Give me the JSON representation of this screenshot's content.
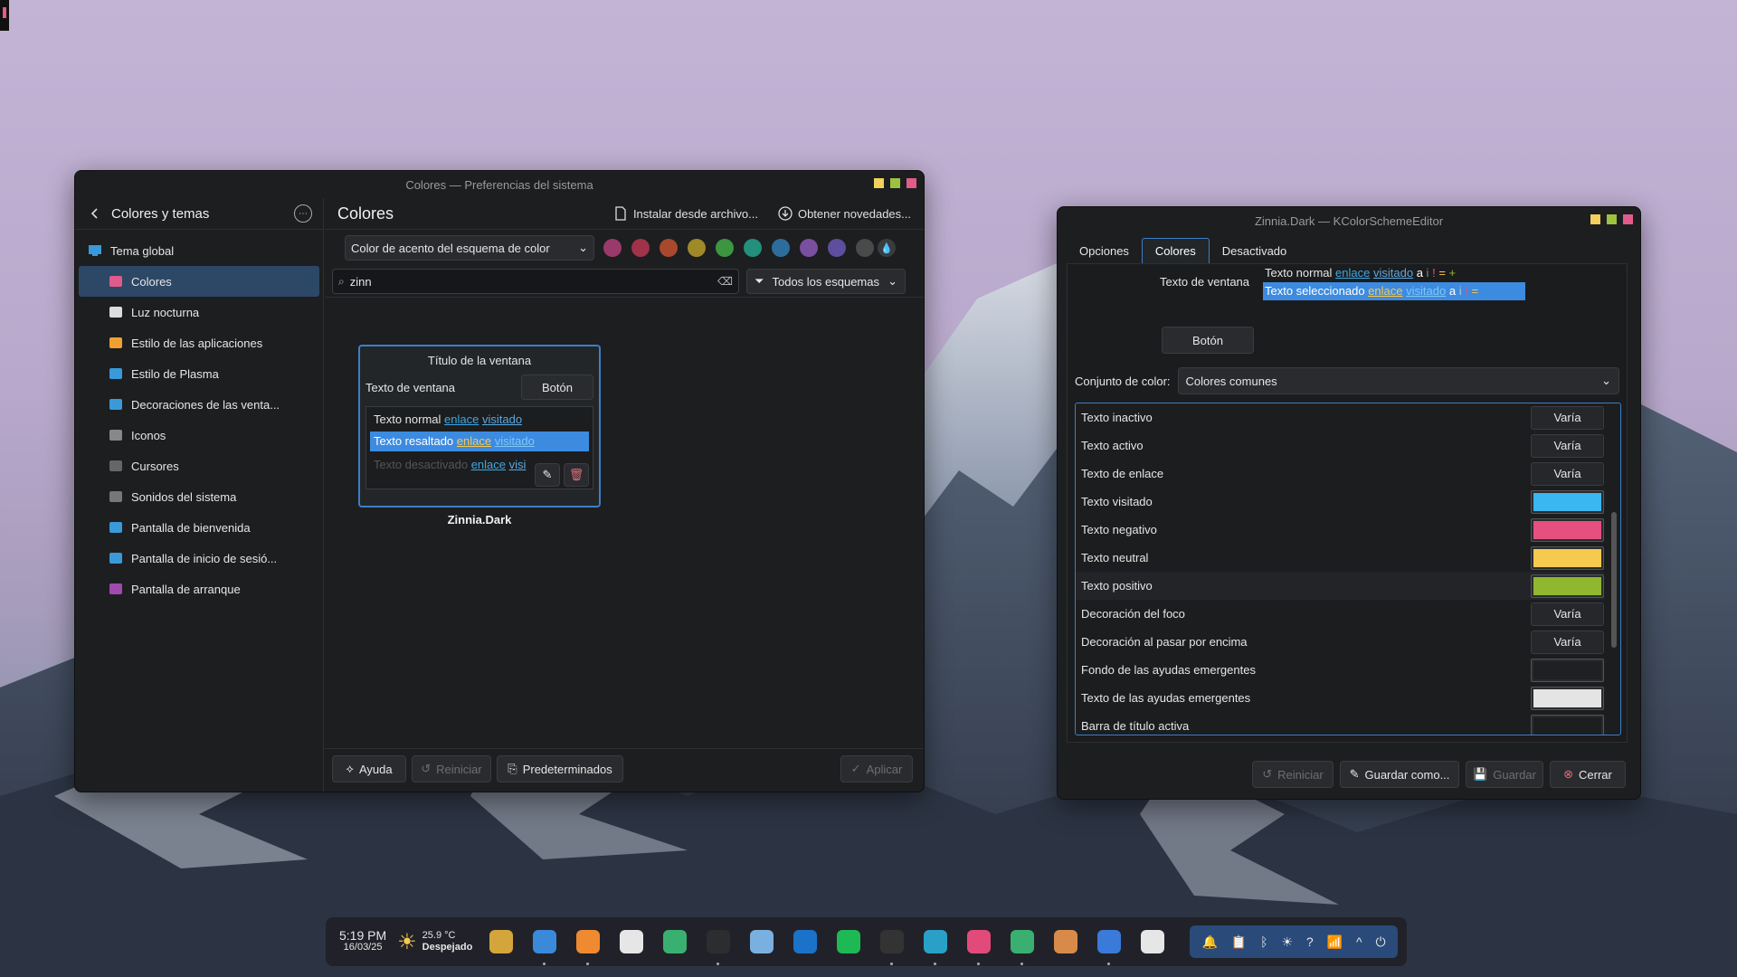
{
  "desktop": {
    "wallpaper": "snowy-mountains"
  },
  "sys_window": {
    "title": "Colores — Preferencias del sistema",
    "back_label": "Colores y temas",
    "sidebar": {
      "header": "Tema global",
      "items": [
        {
          "label": "Colores",
          "icon": "colors-icon"
        },
        {
          "label": "Luz nocturna",
          "icon": "night-light-icon"
        },
        {
          "label": "Estilo de las aplicaciones",
          "icon": "app-style-icon"
        },
        {
          "label": "Estilo de Plasma",
          "icon": "plasma-style-icon"
        },
        {
          "label": "Decoraciones de las venta...",
          "icon": "window-decorations-icon"
        },
        {
          "label": "Iconos",
          "icon": "icons-icon"
        },
        {
          "label": "Cursores",
          "icon": "cursors-icon"
        },
        {
          "label": "Sonidos del sistema",
          "icon": "sounds-icon"
        },
        {
          "label": "Pantalla de bienvenida",
          "icon": "splash-icon"
        },
        {
          "label": "Pantalla de inicio de sesió...",
          "icon": "login-icon"
        },
        {
          "label": "Pantalla de arranque",
          "icon": "boot-icon"
        }
      ]
    },
    "main": {
      "title": "Colores",
      "install_label": "Instalar desde archivo...",
      "get_new_label": "Obtener novedades...",
      "accent_select": "Color de acento del esquema de color",
      "accent_colors": [
        "#9a3a6c",
        "#a0324a",
        "#a8492e",
        "#a08a28",
        "#3c9640",
        "#23907e",
        "#2d6d9c",
        "#7a4fa0",
        "#5d4e9e",
        "#4a4a4a"
      ],
      "search_value": "zinn",
      "filter_select": "Todos los esquemas",
      "preview": {
        "window_title": "Título de la ventana",
        "window_text": "Texto de ventana",
        "button": "Botón",
        "normal_text": "Texto normal",
        "link": "enlace",
        "visited": "visitado",
        "highlighted_text": "Texto resaltado",
        "disabled_text": "Texto desactivado",
        "visited_trunc": "visi",
        "scheme_name": "Zinnia.Dark"
      },
      "footer": {
        "help": "Ayuda",
        "reset": "Reiniciar",
        "defaults": "Predeterminados",
        "apply": "Aplicar"
      }
    }
  },
  "editor_window": {
    "title": "Zinnia.Dark — KColorSchemeEditor",
    "tabs": [
      "Opciones",
      "Colores",
      "Desactivado"
    ],
    "active_tab": "Colores",
    "preview": {
      "window_text": "Texto de ventana",
      "normal_text": "Texto normal",
      "link": "enlace",
      "visited": "visitado",
      "a": "a",
      "i": "i",
      "excl": "!",
      "eq": "=",
      "plus": "+",
      "selected_text": "Texto seleccionado",
      "button": "Botón"
    },
    "color_set_label": "Conjunto de color:",
    "color_set_value": "Colores comunes",
    "rows": [
      {
        "label": "Texto inactivo",
        "kind": "varies",
        "value": "Varía"
      },
      {
        "label": "Texto activo",
        "kind": "varies",
        "value": "Varía"
      },
      {
        "label": "Texto de enlace",
        "kind": "varies",
        "value": "Varía"
      },
      {
        "label": "Texto visitado",
        "kind": "color",
        "color": "#3ab7f0"
      },
      {
        "label": "Texto negativo",
        "kind": "color",
        "color": "#e6507e"
      },
      {
        "label": "Texto neutral",
        "kind": "color",
        "color": "#f6c94f"
      },
      {
        "label": "Texto positivo",
        "kind": "color",
        "color": "#8fb830"
      },
      {
        "label": "Decoración del foco",
        "kind": "varies",
        "value": "Varía"
      },
      {
        "label": "Decoración al pasar por encima",
        "kind": "varies",
        "value": "Varía"
      },
      {
        "label": "Fondo de las ayudas emergentes",
        "kind": "color",
        "color": "#1f2023"
      },
      {
        "label": "Texto de las ayudas emergentes",
        "kind": "color",
        "color": "#e4e4e4"
      },
      {
        "label": "Barra de título activa",
        "kind": "color",
        "color": "#1d1e20"
      }
    ],
    "footer": {
      "reset": "Reiniciar",
      "save_as": "Guardar como...",
      "save": "Guardar",
      "close": "Cerrar"
    }
  },
  "taskbar": {
    "time": "5:19 PM",
    "date": "16/03/25",
    "temperature": "25.9 °C",
    "weather": "Despejado",
    "apps": [
      "kde-icon",
      "files-icon",
      "blender-icon",
      "store-icon",
      "image-viewer-icon",
      "terminal-icon",
      "settings-icon",
      "outlook-icon",
      "spotify-icon",
      "helmet-icon",
      "edge-icon",
      "audio-icon",
      "gallery-icon",
      "paint-icon",
      "code-icon",
      "screenshot-icon"
    ],
    "tray": [
      "notifications-icon",
      "clipboard-icon",
      "bluetooth-icon",
      "brightness-icon",
      "help-icon",
      "wifi-icon",
      "expand-icon",
      "power-icon"
    ]
  }
}
